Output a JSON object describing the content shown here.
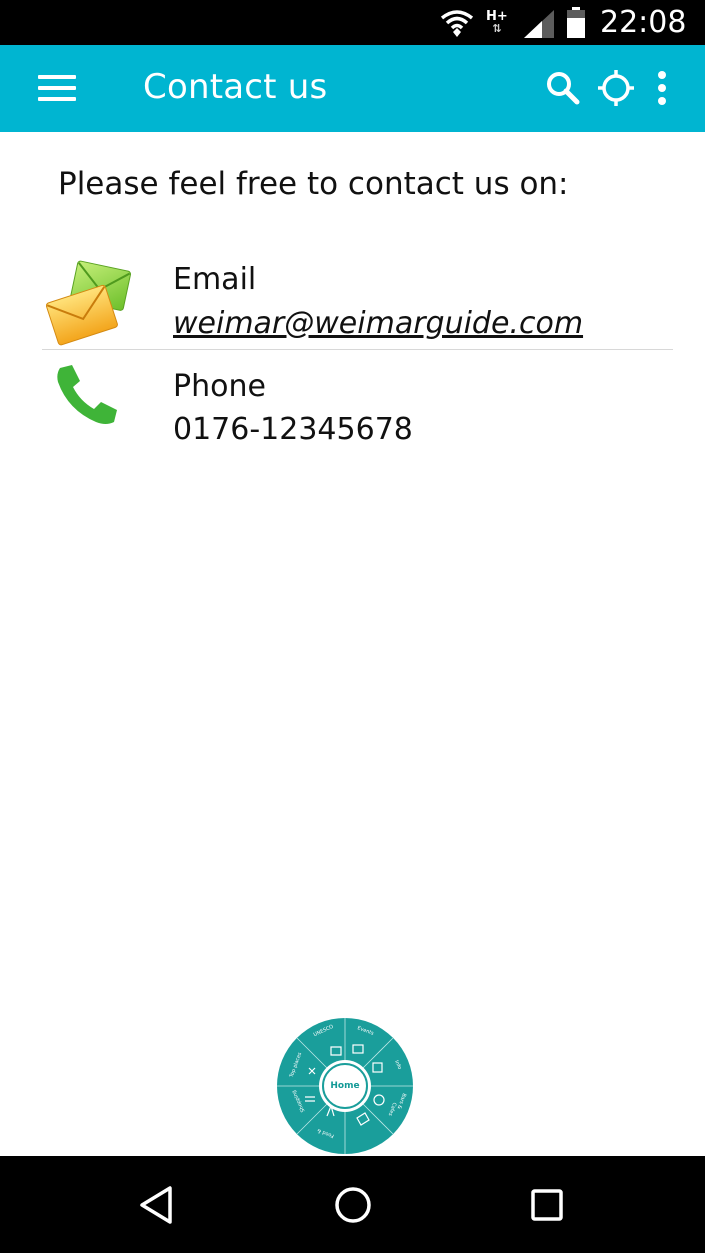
{
  "status_bar": {
    "network_type": "H+",
    "network_arrows": "⇅",
    "time": "22:08",
    "icons": [
      "wifi-icon",
      "signal-icon",
      "battery-icon"
    ]
  },
  "app_bar": {
    "title": "Contact us",
    "background_color": "#00b5d1",
    "icons": [
      "menu-icon",
      "search-icon",
      "locate-icon",
      "more-vert-icon"
    ]
  },
  "content": {
    "intro": "Please feel free to contact us on:",
    "contacts": [
      {
        "label": "Email",
        "value": "weimar@weimarguide.com",
        "icon": "email-envelope-icon"
      },
      {
        "label": "Phone",
        "value": "0176-12345678",
        "icon": "phone-icon"
      }
    ]
  },
  "radial_menu": {
    "center_label": "Home",
    "color": "#1a9e9b",
    "segments": [
      "Events",
      "Info",
      "Bars &",
      "Cafes",
      "Food &",
      "Shopping",
      "Top places",
      "UNESCO"
    ]
  },
  "nav_bar": {
    "icons": [
      "back-icon",
      "home-circle-icon",
      "recents-icon"
    ]
  }
}
